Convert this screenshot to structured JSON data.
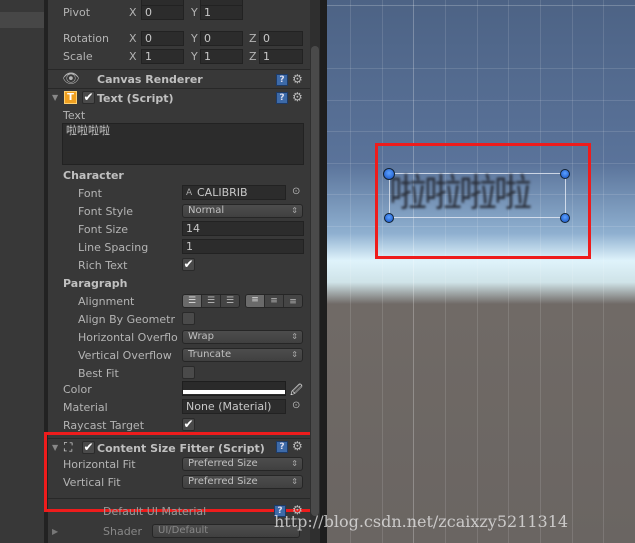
{
  "transform": {
    "pivot": {
      "label": "Pivot",
      "x": "0",
      "y": "1"
    },
    "rotation": {
      "label": "Rotation",
      "x": "0",
      "y": "0",
      "z": "0"
    },
    "scale": {
      "label": "Scale",
      "x": "1",
      "y": "1",
      "z": "1"
    },
    "axis": {
      "x": "X",
      "y": "Y",
      "z": "Z"
    }
  },
  "canvas_renderer": {
    "title": "Canvas Renderer"
  },
  "text_script": {
    "title": "Text (Script)",
    "text_label": "Text",
    "text_value": "啦啦啦啦",
    "character": "Character",
    "font_label": "Font",
    "font_value": "CALIBRIB",
    "font_style_label": "Font Style",
    "font_style_value": "Normal",
    "font_size_label": "Font Size",
    "font_size_value": "14",
    "line_spacing_label": "Line Spacing",
    "line_spacing_value": "1",
    "rich_text_label": "Rich Text",
    "rich_text": true,
    "paragraph": "Paragraph",
    "alignment_label": "Alignment",
    "align_geometry_label": "Align By Geometr",
    "align_geometry": false,
    "h_overflow_label": "Horizontal Overflo",
    "h_overflow_value": "Wrap",
    "v_overflow_label": "Vertical Overflow",
    "v_overflow_value": "Truncate",
    "best_fit_label": "Best Fit",
    "best_fit": false,
    "color_label": "Color",
    "color_value": "#ffffff",
    "material_label": "Material",
    "material_value": "None (Material)",
    "raycast_label": "Raycast Target",
    "raycast": true
  },
  "content_size_fitter": {
    "title": "Content Size Fitter (Script)",
    "h_fit_label": "Horizontal Fit",
    "h_fit_value": "Preferred Size",
    "v_fit_label": "Vertical Fit",
    "v_fit_value": "Preferred Size"
  },
  "material_section": {
    "title": "Default UI Material",
    "shader_label": "Shader",
    "shader_value": "UI/Default"
  },
  "scene": {
    "text": "啦啦啦啦"
  },
  "watermark": "http://blog.csdn.net/zcaixzy5211314",
  "colors": {
    "highlight": "#ee1c1c",
    "handle": "#2f7cf0"
  }
}
